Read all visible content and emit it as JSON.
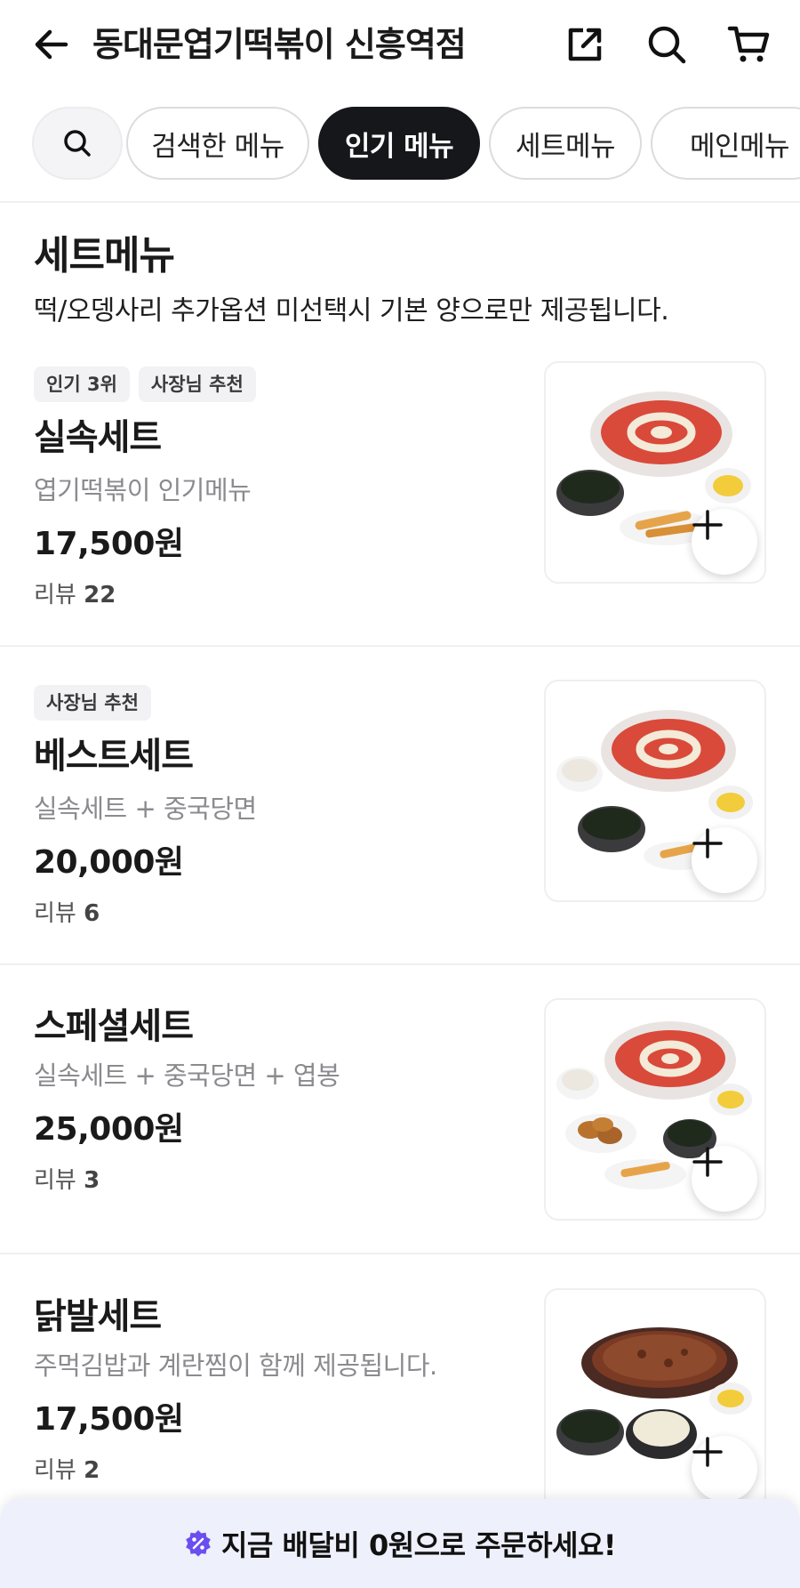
{
  "header": {
    "store_name": "동대문엽기떡볶이 신흥역점",
    "back_icon": "arrow-left-icon",
    "share_icon": "share-icon",
    "search_icon": "search-icon",
    "cart_icon": "cart-icon"
  },
  "tabs": [
    {
      "label": "검색한 메뉴",
      "active": false
    },
    {
      "label": "인기 메뉴",
      "active": true
    },
    {
      "label": "세트메뉴",
      "active": false
    },
    {
      "label": "메인메뉴",
      "active": false
    }
  ],
  "section": {
    "title": "세트메뉴",
    "description": "떡/오뎅사리 추가옵션 미선택시 기본 양으로만 제공됩니다."
  },
  "items": [
    {
      "badges": [
        "인기 3위",
        "사장님 추천"
      ],
      "name": "실속세트",
      "desc": "엽기떡볶이 인기메뉴",
      "price": "17,500원",
      "review_label": "리뷰",
      "review_count": "22"
    },
    {
      "badges": [
        "사장님 추천"
      ],
      "name": "베스트세트",
      "desc": "실속세트 + 중국당면",
      "price": "20,000원",
      "review_label": "리뷰",
      "review_count": "6"
    },
    {
      "badges": [],
      "name": "스페셜세트",
      "desc": "실속세트 + 중국당면 + 엽봉",
      "price": "25,000원",
      "review_label": "리뷰",
      "review_count": "3"
    },
    {
      "badges": [],
      "name": "닭발세트",
      "desc": "주먹김밥과 계란찜이 함께 제공됩니다.",
      "price": "17,500원",
      "review_label": "리뷰",
      "review_count": "2"
    }
  ],
  "promo": {
    "text": "지금 배달비 0원으로 주문하세요!",
    "icon": "discount-badge-icon",
    "icon_color": "#6b4ef0"
  },
  "colors": {
    "active_tab": "#16171a",
    "promo_background": "#eef0fb"
  }
}
